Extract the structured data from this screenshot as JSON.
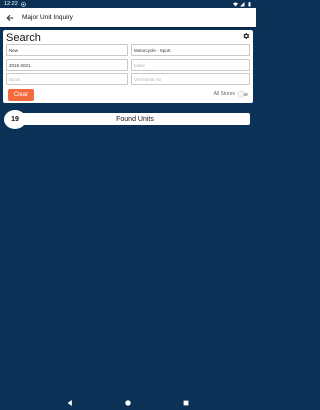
{
  "status_bar": {
    "time": "12:22",
    "icons": [
      "notification-icon",
      "wifi-icon",
      "signal-icon",
      "battery-icon"
    ]
  },
  "app_bar": {
    "title": "Major Unit Inquiry",
    "back_icon": "arrow-back-icon"
  },
  "search": {
    "title": "Search",
    "settings_icon": "gear-icon",
    "fields": {
      "condition": {
        "value": "New",
        "placeholder": ""
      },
      "unit_type": {
        "value": "Motorcycle - Sport",
        "placeholder": ""
      },
      "year": {
        "value": "2015-2021",
        "placeholder": ""
      },
      "make": {
        "value": "",
        "placeholder": "Make"
      },
      "stock": {
        "value": "",
        "placeholder": "Stock"
      },
      "vin": {
        "value": "",
        "placeholder": "VIN/Serial No"
      }
    },
    "clear_label": "Clear",
    "all_stores_label": "All Stores",
    "all_stores_on": false
  },
  "results": {
    "count": "19",
    "label": "Found Units"
  },
  "nav_bar": {
    "icons": [
      "back-triangle-icon",
      "home-circle-icon",
      "recents-square-icon"
    ]
  },
  "colors": {
    "background": "#0b3157",
    "accent": "#f26a3d",
    "card": "#ffffff"
  }
}
